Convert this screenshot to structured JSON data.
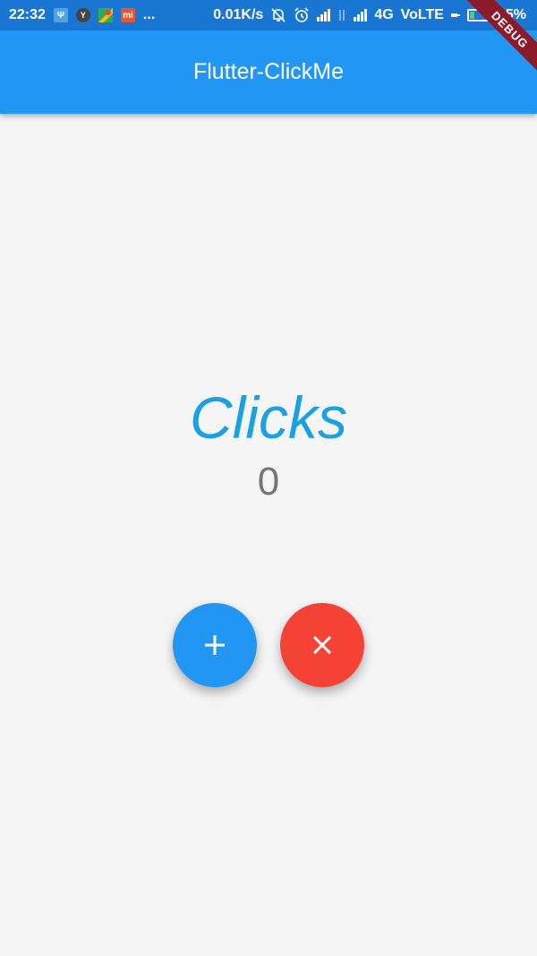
{
  "status_bar": {
    "time": "22:32",
    "ellipsis": "...",
    "net_speed": "0.01K/s",
    "network_type": "4G",
    "volte": "VoLTE",
    "battery_percent": "25%",
    "battery_level": 0.25
  },
  "debug_banner": "DEBUG",
  "app_bar": {
    "title": "Flutter-ClickMe"
  },
  "counter": {
    "label": "Clicks",
    "value": "0"
  },
  "actions": {
    "increment_icon": "plus-icon",
    "reset_icon": "close-icon"
  },
  "colors": {
    "status_bar": "#1976d2",
    "app_bar": "#2196f3",
    "clicks_text": "#1ba1e2",
    "count_text": "#757575",
    "increment_button": "#2196f3",
    "reset_button": "#f44336",
    "background": "#f5f5f5"
  }
}
